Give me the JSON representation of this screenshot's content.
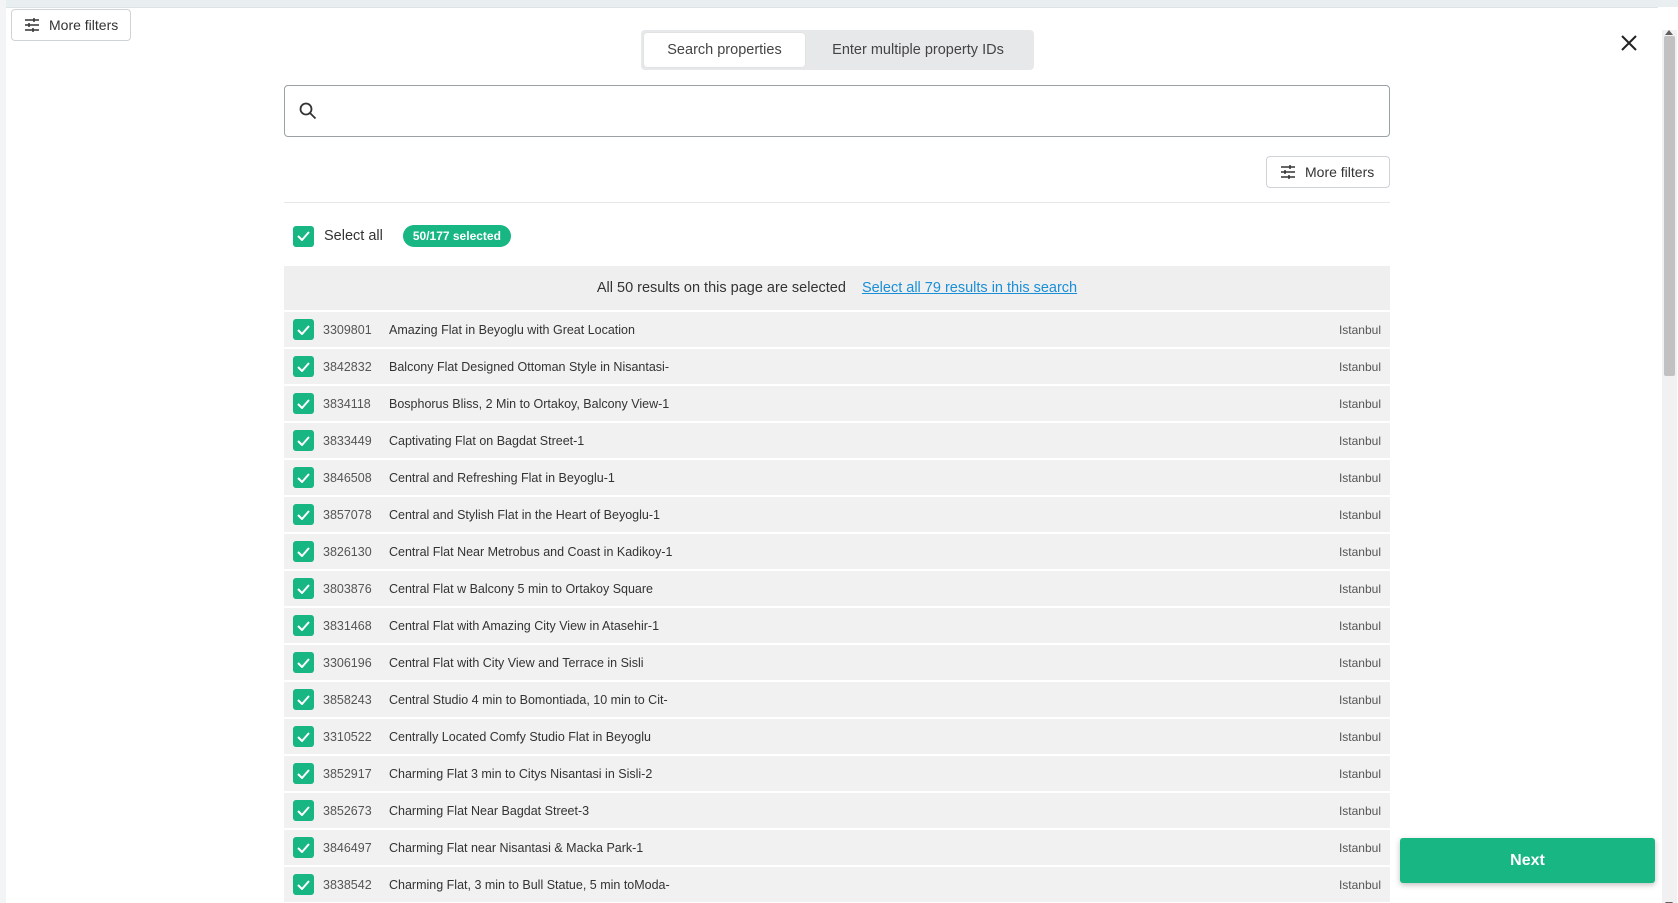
{
  "outer_toolbar": {
    "more_filters_label": "More filters"
  },
  "tabs": [
    {
      "label": "Search properties",
      "active": true
    },
    {
      "label": "Enter multiple property IDs",
      "active": false
    }
  ],
  "search": {
    "value": "",
    "placeholder": ""
  },
  "filters": {
    "more_filters_label": "More filters"
  },
  "selection": {
    "select_all_label": "Select all",
    "badge": "50/177 selected",
    "banner_text": "All 50 results on this page are selected",
    "banner_link": "Select all 79 results in this search"
  },
  "properties": [
    {
      "id": "3309801",
      "name": "Amazing Flat in Beyoglu with Great Location",
      "city": "Istanbul",
      "checked": true
    },
    {
      "id": "3842832",
      "name": "Balcony Flat Designed Ottoman Style in Nisantasi-",
      "city": "Istanbul",
      "checked": true
    },
    {
      "id": "3834118",
      "name": "Bosphorus Bliss, 2 Min to Ortakoy, Balcony View-1",
      "city": "Istanbul",
      "checked": true
    },
    {
      "id": "3833449",
      "name": "Captivating Flat on Bagdat Street-1",
      "city": "Istanbul",
      "checked": true
    },
    {
      "id": "3846508",
      "name": "Central and Refreshing Flat in Beyoglu-1",
      "city": "Istanbul",
      "checked": true
    },
    {
      "id": "3857078",
      "name": "Central and Stylish Flat in the Heart of Beyoglu-1",
      "city": "Istanbul",
      "checked": true
    },
    {
      "id": "3826130",
      "name": "Central Flat Near Metrobus and Coast in Kadikoy-1",
      "city": "Istanbul",
      "checked": true
    },
    {
      "id": "3803876",
      "name": "Central Flat w Balcony 5 min to Ortakoy Square",
      "city": "Istanbul",
      "checked": true
    },
    {
      "id": "3831468",
      "name": "Central Flat with Amazing City View in Atasehir-1",
      "city": "Istanbul",
      "checked": true
    },
    {
      "id": "3306196",
      "name": "Central Flat with City View and Terrace in Sisli",
      "city": "Istanbul",
      "checked": true
    },
    {
      "id": "3858243",
      "name": "Central Studio 4 min to Bomontiada, 10 min to Cit-",
      "city": "Istanbul",
      "checked": true
    },
    {
      "id": "3310522",
      "name": "Centrally Located Comfy Studio Flat in Beyoglu",
      "city": "Istanbul",
      "checked": true
    },
    {
      "id": "3852917",
      "name": "Charming Flat 3 min to Citys Nisantasi in Sisli-2",
      "city": "Istanbul",
      "checked": true
    },
    {
      "id": "3852673",
      "name": "Charming Flat Near Bagdat Street-3",
      "city": "Istanbul",
      "checked": true
    },
    {
      "id": "3846497",
      "name": "Charming Flat near Nisantasi & Macka Park-1",
      "city": "Istanbul",
      "checked": true
    },
    {
      "id": "3838542",
      "name": "Charming Flat, 3 min to Bull Statue, 5 min toModa-",
      "city": "Istanbul",
      "checked": true
    }
  ],
  "footer": {
    "next_label": "Next"
  },
  "colors": {
    "accent": "#17b683",
    "link": "#1a8fd6"
  },
  "icons": {
    "close": "close-icon",
    "search": "search-icon",
    "filters": "sliders-icon",
    "check": "checkmark-icon"
  }
}
